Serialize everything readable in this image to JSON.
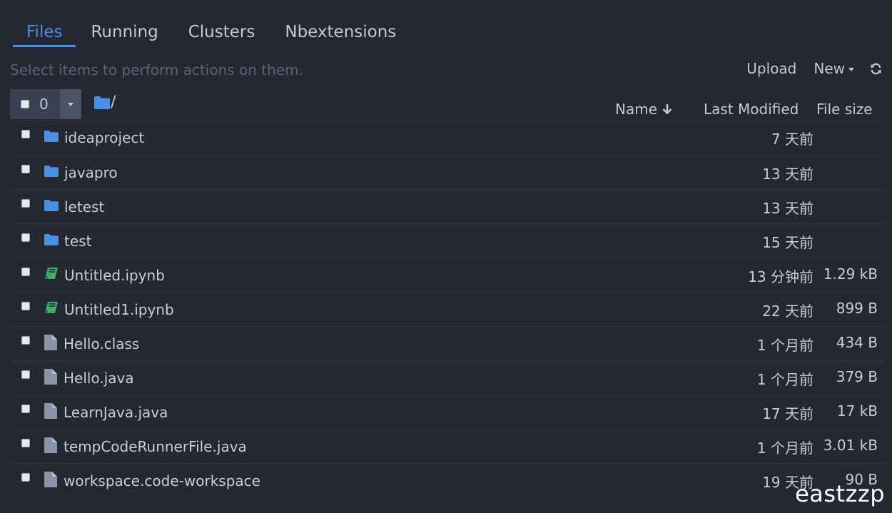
{
  "tabs": [
    {
      "label": "Files",
      "active": true
    },
    {
      "label": "Running",
      "active": false
    },
    {
      "label": "Clusters",
      "active": false
    },
    {
      "label": "Nbextensions",
      "active": false
    }
  ],
  "hint": "Select items to perform actions on them.",
  "actions": {
    "upload_label": "Upload",
    "new_label": "New",
    "refresh_icon": "refresh-icon"
  },
  "selection": {
    "count": "0"
  },
  "breadcrumb": {
    "root_icon": "folder-icon",
    "path": "/"
  },
  "columns": {
    "name": "Name",
    "last_modified": "Last Modified",
    "file_size": "File size"
  },
  "files": [
    {
      "name": "ideaproject",
      "type": "folder",
      "modified": "7 天前",
      "size": ""
    },
    {
      "name": "javapro",
      "type": "folder",
      "modified": "13 天前",
      "size": ""
    },
    {
      "name": "letest",
      "type": "folder",
      "modified": "13 天前",
      "size": ""
    },
    {
      "name": "test",
      "type": "folder",
      "modified": "15 天前",
      "size": ""
    },
    {
      "name": "Untitled.ipynb",
      "type": "notebook",
      "modified": "13 分钟前",
      "size": "1.29 kB"
    },
    {
      "name": "Untitled1.ipynb",
      "type": "notebook",
      "modified": "22 天前",
      "size": "899 B"
    },
    {
      "name": "Hello.class",
      "type": "file",
      "modified": "1 个月前",
      "size": "434 B"
    },
    {
      "name": "Hello.java",
      "type": "file",
      "modified": "1 个月前",
      "size": "379 B"
    },
    {
      "name": "LearnJava.java",
      "type": "file",
      "modified": "17 天前",
      "size": "17 kB"
    },
    {
      "name": "tempCodeRunnerFile.java",
      "type": "file",
      "modified": "1 个月前",
      "size": "3.01 kB"
    },
    {
      "name": "workspace.code-workspace",
      "type": "file",
      "modified": "19 天前",
      "size": "90 B"
    }
  ],
  "colors": {
    "background": "#252833",
    "accent": "#4a90e2",
    "folder": "#4a90e2",
    "notebook": "#3fae6b",
    "file": "#8a93a5"
  },
  "watermark": "eastzzp"
}
